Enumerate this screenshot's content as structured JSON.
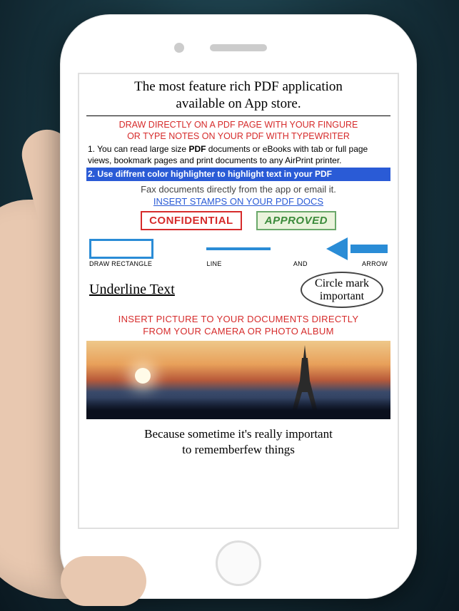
{
  "title_line1": "The most feature rich PDF application",
  "title_line2": "available on App store.",
  "draw_head_line1": "DRAW DIRECTLY ON A PDF PAGE WITH YOUR FINGURE",
  "draw_head_line2": "OR TYPE NOTES ON YOUR PDF WITH TYPEWRITER",
  "feat1_prefix": "1. You can read large size ",
  "feat1_bold": "PDF",
  "feat1_rest": " documents or eBooks with tab or full page views, bookmark pages and print documents to any AirPrint printer.",
  "feat2": "2. Use diffrent color highlighter to highlight text in your PDF",
  "fax_text": "Fax documents directly from the app or email it.",
  "stamp_link": "INSERT STAMPS ON YOUR PDF DOCS",
  "stamp_confidential": "CONFIDENTIAL",
  "stamp_approved": "APPROVED",
  "label_rect": "DRAW RECTANGLE",
  "label_line": "LINE",
  "label_and": "AND",
  "label_arrow": "ARROW",
  "underline_text": "Underline Text",
  "circle_line1": "Circle mark",
  "circle_line2": "important",
  "pic_head_line1": "INSERT PICTURE TO YOUR DOCUMENTS  DIRECTLY",
  "pic_head_line2": "FROM YOUR CAMERA OR PHOTO ALBUM",
  "bottom_line1": "Because sometime it's really important",
  "bottom_line2": "to rememberfew things"
}
